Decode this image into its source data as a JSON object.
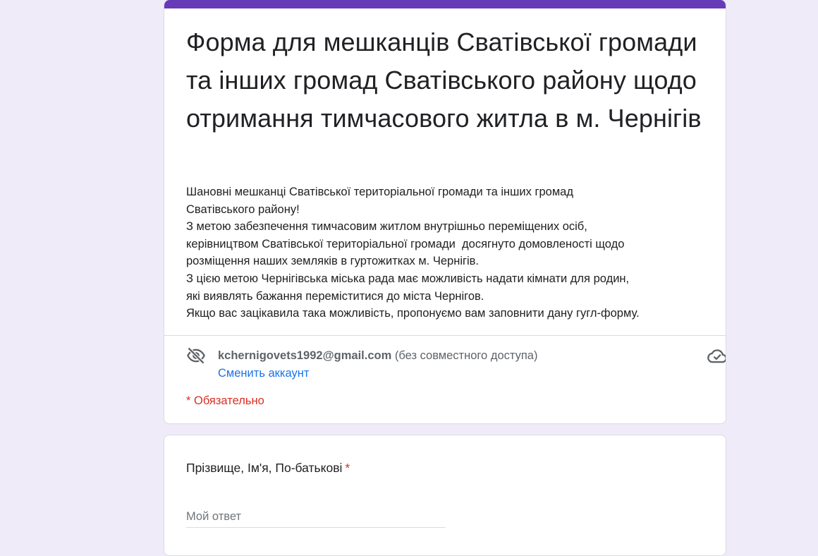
{
  "form": {
    "accent_color": "#673ab7",
    "title": "Форма для мешканців Сватівської громади та інших громад Сватівського району щодо отримання тимчасового житла в м. Чернігів",
    "description_lines": [
      "Шановні мешканці Сватівської територіальної громади та інших громад",
      "Сватівського району!",
      "З метою забезпечення тимчасовим житлом внутрішньо переміщених осіб,",
      "керівництвом Сватівської територіальної громади  досягнуто домовленості щодо",
      "розміщення наших земляків в гуртожитках м. Чернігів.",
      "З цією метою Чернігівська міська рада має можливість надати кімнати для родин,",
      "які виявлять бажання переміститися до міста Чернігов.",
      "Якщо вас зацікавила така можливість, пропонуємо вам заповнити дану гугл-форму."
    ]
  },
  "account": {
    "email": "kchernigovets1992@gmail.com",
    "sharing_note": "(без совместного доступа)",
    "switch_label": "Сменить аккаунт",
    "privacy_icon": "eye-off-icon",
    "status_icon": "cloud-check-icon"
  },
  "required_note": "* Обязательно",
  "question": {
    "title": "Прізвище, Ім'я, По-батькові",
    "required_marker": "*",
    "placeholder": "Мой ответ",
    "value": ""
  }
}
